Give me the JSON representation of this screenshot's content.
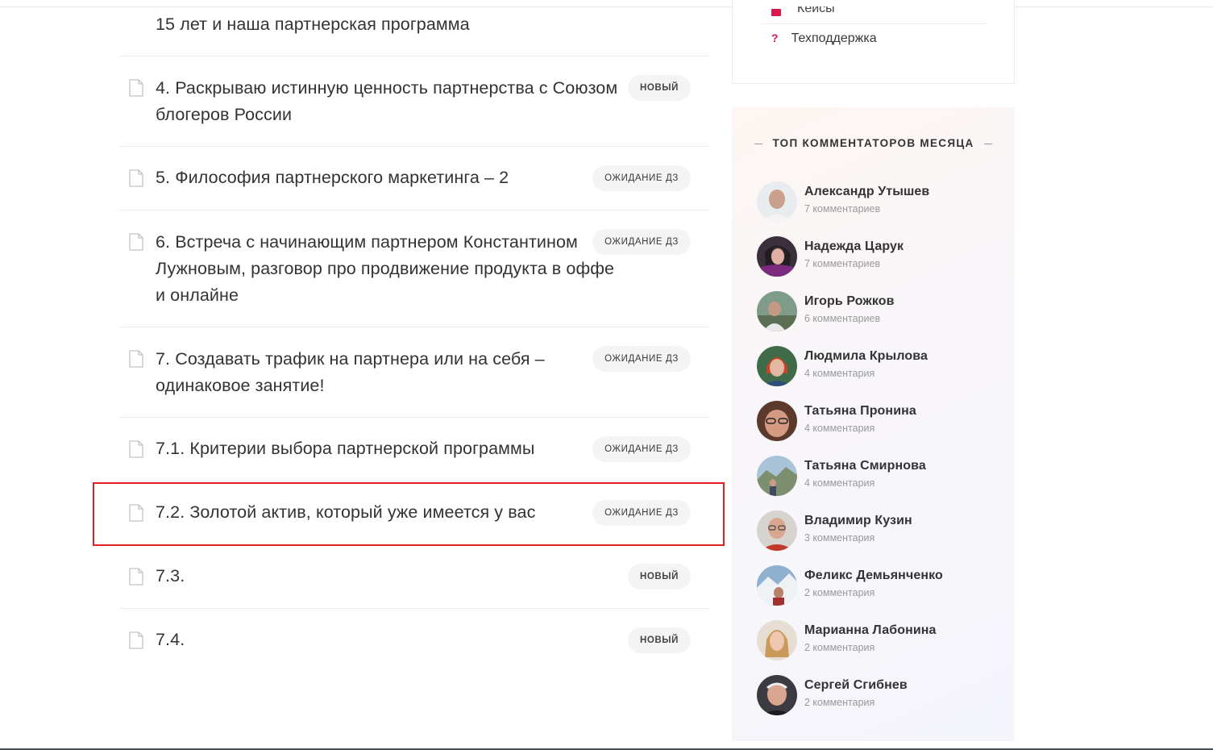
{
  "lessons": [
    {
      "title": "15 лет и наша партнерская программа",
      "badge": ""
    },
    {
      "title": "4. Раскрываю истинную ценность партнерства с Союзом блогеров России",
      "badge": "НОВЫЙ"
    },
    {
      "title": "5. Философия партнерского маркетинга – 2",
      "badge": "ОЖИДАНИЕ ДЗ"
    },
    {
      "title": "6. Встреча с начинающим партнером Константином Лужновым, разговор про продвижение продукта в оффе и онлайне",
      "badge": "ОЖИДАНИЕ ДЗ"
    },
    {
      "title": "7. Создавать трафик на партнера или на себя – одинаковое занятие!",
      "badge": "ОЖИДАНИЕ ДЗ"
    },
    {
      "title": "7.1. Критерии выбора партнерской программы",
      "badge": "ОЖИДАНИЕ ДЗ"
    },
    {
      "title": "7.2. Золотой актив, который уже имеется у вас",
      "badge": "ОЖИДАНИЕ ДЗ"
    },
    {
      "title": "7.3.",
      "badge": "НОВЫЙ"
    },
    {
      "title": "7.4.",
      "badge": "НОВЫЙ"
    }
  ],
  "sidebar": {
    "prev_item": "Кейсы",
    "support": "Техподдержка",
    "support_icon": "?"
  },
  "top_commenters": {
    "title": "ТОП КОММЕНТАТОРОВ МЕСЯЦА",
    "people": [
      {
        "name": "Александр Утышев",
        "count": "7 комментариев"
      },
      {
        "name": "Надежда Царук",
        "count": "7 комментариев"
      },
      {
        "name": "Игорь Рожков",
        "count": "6 комментариев"
      },
      {
        "name": "Людмила Крылова",
        "count": "4 комментария"
      },
      {
        "name": "Татьяна Пронина",
        "count": "4 комментария"
      },
      {
        "name": "Татьяна Смирнова",
        "count": "4 комментария"
      },
      {
        "name": "Владимир Кузин",
        "count": "3 комментария"
      },
      {
        "name": "Феликс Демьянченко",
        "count": "2 комментария"
      },
      {
        "name": "Марианна Лабонина",
        "count": "2 комментария"
      },
      {
        "name": "Сергей Сгибнев",
        "count": "2 комментария"
      }
    ]
  },
  "colors": {
    "accent": "#d8174f",
    "highlight": "#e01e1e"
  }
}
